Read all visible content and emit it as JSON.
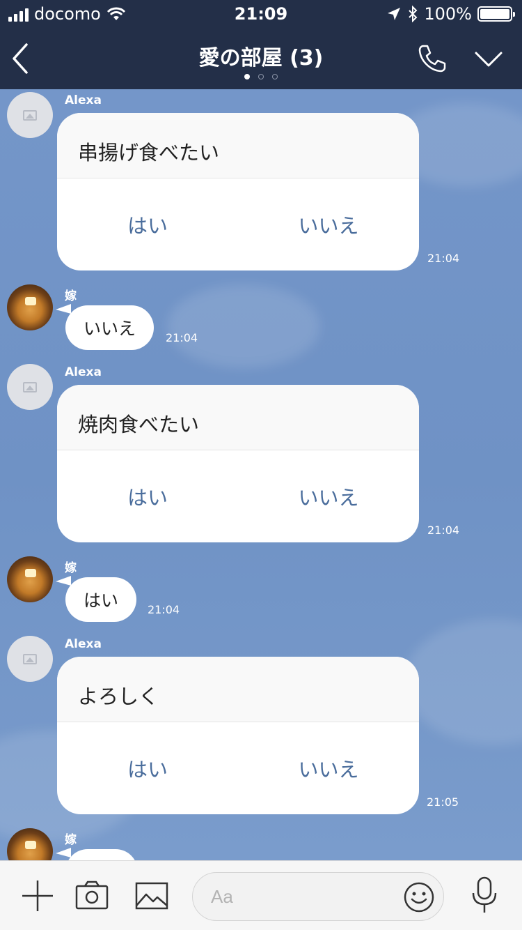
{
  "status_bar": {
    "carrier": "docomo",
    "time": "21:09",
    "battery": "100%"
  },
  "nav": {
    "title": "愛の部屋 (3)",
    "page_count": 3,
    "active_page": 1
  },
  "messages": [
    {
      "sender": "Alexa",
      "text": "串揚げ食べたい",
      "yes": "はい",
      "no": "いいえ",
      "time": "21:04"
    },
    {
      "sender": "嫁",
      "text": "いいえ",
      "time": "21:04"
    },
    {
      "sender": "Alexa",
      "text": "焼肉食べたい",
      "yes": "はい",
      "no": "いいえ",
      "time": "21:04"
    },
    {
      "sender": "嫁",
      "text": "はい",
      "time": "21:04"
    },
    {
      "sender": "Alexa",
      "text": "よろしく",
      "yes": "はい",
      "no": "いいえ",
      "time": "21:05"
    },
    {
      "sender": "嫁"
    }
  ],
  "composer": {
    "placeholder": "Aa"
  },
  "colors": {
    "header_bg": "#232f48",
    "chat_bg": "#7496c9",
    "option_text": "#4a6d9c"
  },
  "icons": [
    "back-icon",
    "phone-icon",
    "chevron-down-icon",
    "plus-icon",
    "camera-icon",
    "image-icon",
    "emoji-icon",
    "microphone-icon"
  ]
}
